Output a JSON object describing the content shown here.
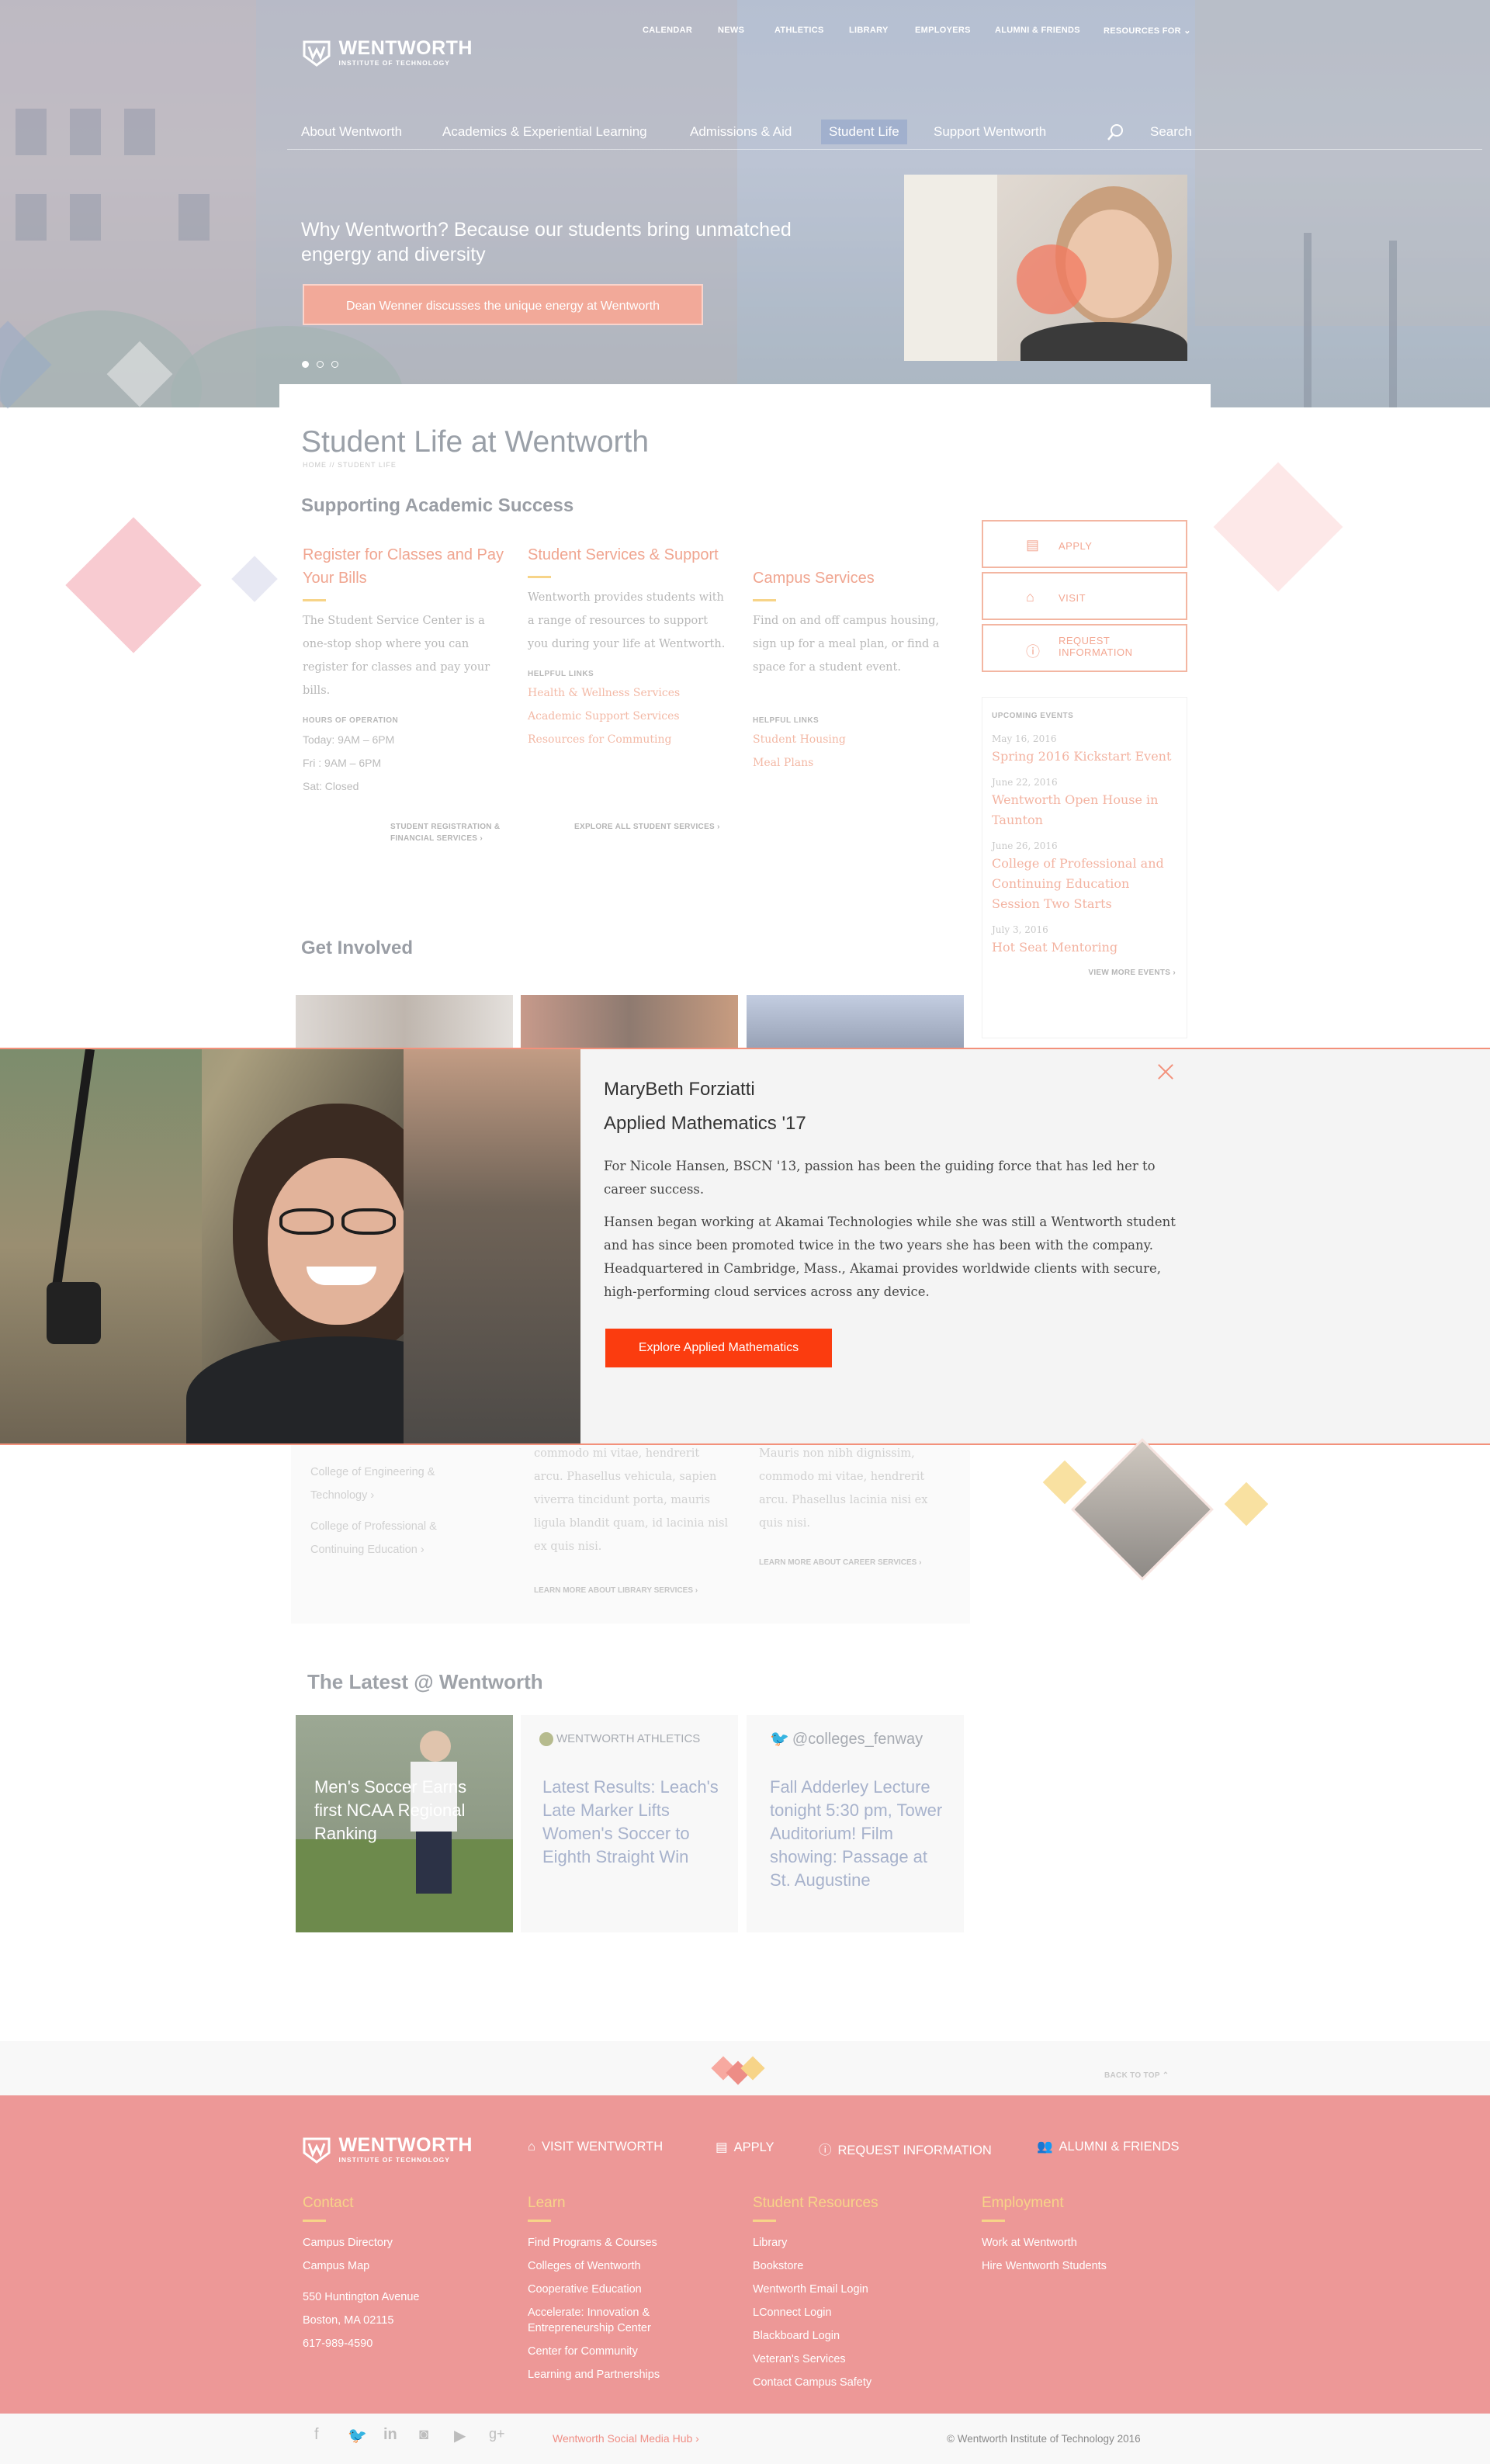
{
  "brand": {
    "name": "WENTWORTH",
    "sub": "INSTITUTE OF TECHNOLOGY"
  },
  "utility_nav": [
    "CALENDAR",
    "NEWS",
    "ATHLETICS",
    "LIBRARY",
    "EMPLOYERS",
    "ALUMNI & FRIENDS",
    "RESOURCES FOR"
  ],
  "main_nav": [
    "About Wentworth",
    "Academics & Experiential Learning",
    "Admissions & Aid",
    "Student Life",
    "Support Wentworth"
  ],
  "search_label": "Search",
  "hero": {
    "title": "Why Wentworth? Because our students bring unmatched engergy and diversity",
    "button": "Dean Wenner discusses the unique energy at Wentworth"
  },
  "page": {
    "title": "Student Life at Wentworth",
    "breadcrumb": "HOME  //  STUDENT LIFE",
    "section1": "Supporting Academic Success"
  },
  "columns": [
    {
      "title": "Register for Classes and Pay Your Bills",
      "text": "The Student Service Center is a one-stop shop where you can register for classes and pay your bills.",
      "label": "HOURS OF OPERATION",
      "items": [
        "Today: 9AM – 6PM",
        "Fri : 9AM – 6PM",
        "Sat: Closed"
      ],
      "more": "STUDENT REGISTRATION & FINANCIAL SERVICES"
    },
    {
      "title": "Student Services & Support",
      "text": "Wentworth provides students with a range of resources to support you during your life at Wentworth.",
      "label": "HELPFUL LINKS",
      "items": [
        "Health & Wellness Services",
        "Academic Support Services",
        "Resources for Commuting"
      ],
      "more": "EXPLORE ALL STUDENT SERVICES"
    },
    {
      "title": "Campus Services",
      "text": "Find on and off campus housing, sign up for a meal plan, or find a space for a student event.",
      "label": "HELPFUL LINKS",
      "items": [
        "Student Housing",
        "Meal Plans"
      ]
    }
  ],
  "side_buttons": [
    "APPLY",
    "VISIT",
    "REQUEST INFORMATION"
  ],
  "events": {
    "label": "UPCOMING EVENTS",
    "items": [
      {
        "date": "May 16, 2016",
        "name": "Spring 2016 Kickstart Event"
      },
      {
        "date": "June 22, 2016",
        "name": "Wentworth Open House in Taunton"
      },
      {
        "date": "June 26, 2016",
        "name": "College of Professional and Continuing Education Session Two Starts"
      },
      {
        "date": "July 3, 2016",
        "name": "Hot Seat Mentoring"
      }
    ],
    "more": "VIEW MORE EVENTS"
  },
  "get_involved": "Get Involved",
  "modal": {
    "name": "MaryBeth Forziatti",
    "program": "Applied Mathematics '17",
    "p1": "For Nicole Hansen, BSCN '13, passion has been the guiding force that has led her to career success.",
    "p2": "Hansen began working at Akamai Technologies while she was still a Wentworth student and has since been promoted twice in the two years she has been with the company. Headquartered in Cambridge, Mass., Akamai provides worldwide clients with secure, high-performing cloud services across any device.",
    "button": "Explore Applied Mathematics"
  },
  "faded": {
    "links": [
      "College of Engineering & Technology",
      "College of Professional & Continuing Education"
    ],
    "col2": "commodo mi vitae, hendrerit arcu. Phasellus vehicula, sapien viverra tincidunt porta, mauris ligula blandit quam, id lacinia nisl ex quis nisi.",
    "col2_more": "LEARN MORE ABOUT LIBRARY SERVICES",
    "col3": "Mauris non nibh dignissim, commodo mi vitae, hendrerit arcu. Phasellus lacinia nisi ex quis nisi.",
    "col3_more": "LEARN MORE ABOUT CAREER SERVICES"
  },
  "latest": {
    "title": "The Latest @ Wentworth",
    "t1": "Men's Soccer Earns first NCAA Regional Ranking",
    "t2_source": "WENTWORTH ATHLETICS",
    "t2": "Latest Results: Leach's Late Marker Lifts Women's Soccer to Eighth Straight Win",
    "t3_source": "@colleges_fenway",
    "t3": "Fall Adderley Lecture tonight 5:30 pm, Tower Auditorium! Film showing: Passage at St. Augustine"
  },
  "back_to_top": "BACK TO TOP",
  "footer": {
    "top_links": [
      "VISIT WENTWORTH",
      "APPLY",
      "REQUEST INFORMATION",
      "ALUMNI & FRIENDS"
    ],
    "cols": [
      {
        "title": "Contact",
        "links": [
          "Campus Directory",
          "Campus Map",
          "550 Huntington Avenue",
          "Boston, MA 02115",
          "617-989-4590"
        ]
      },
      {
        "title": "Learn",
        "links": [
          "Find Programs & Courses",
          "Colleges of Wentworth",
          "Cooperative Education",
          "Accelerate: Innovation & Entrepreneurship Center",
          "Center for Community",
          "Learning and Partnerships"
        ]
      },
      {
        "title": "Student Resources",
        "links": [
          "Library",
          "Bookstore",
          "Wentworth Email Login",
          "LConnect Login",
          "Blackboard Login",
          "Veteran's Services",
          "Contact Campus Safety"
        ]
      },
      {
        "title": "Employment",
        "links": [
          "Work at Wentworth",
          "Hire Wentworth Students"
        ]
      }
    ],
    "hub": "Wentworth Social Media Hub",
    "copyright": "© Wentworth Institute of Technology 2016"
  },
  "colors": {
    "accent": "#f3917b",
    "cta": "#fb3c0f",
    "footer": "#ed9897",
    "gold": "#f7d488"
  }
}
